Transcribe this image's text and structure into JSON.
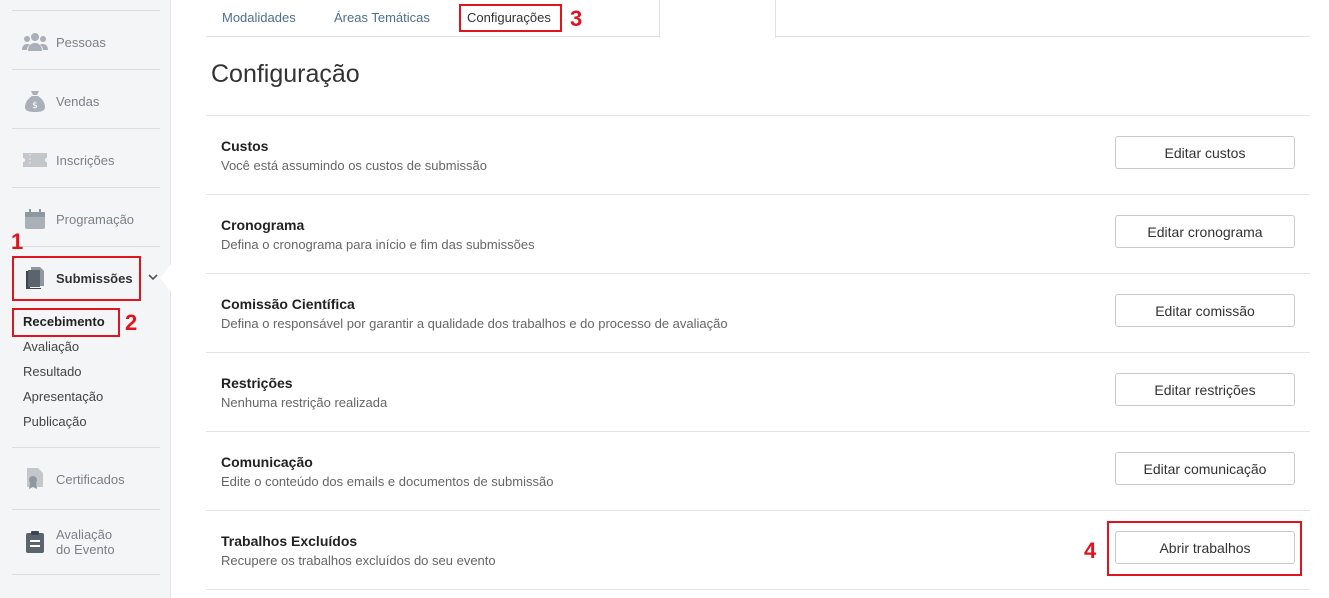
{
  "sidebar": {
    "items": [
      {
        "label": "Pessoas",
        "icon": "people-icon"
      },
      {
        "label": "Vendas",
        "icon": "money-bag-icon"
      },
      {
        "label": "Inscrições",
        "icon": "ticket-icon"
      },
      {
        "label": "Programação",
        "icon": "calendar-icon"
      },
      {
        "label": "Submissões",
        "icon": "document-icon"
      },
      {
        "label": "Certificados",
        "icon": "certificate-icon"
      },
      {
        "label_line1": "Avaliação",
        "label_line2": "do Evento",
        "icon": "clipboard-icon"
      }
    ],
    "submenu": [
      "Recebimento",
      "Avaliação",
      "Resultado",
      "Apresentação",
      "Publicação"
    ]
  },
  "tabs": [
    "Modalidades",
    "Áreas Temáticas",
    "Configurações"
  ],
  "page_title": "Configuração",
  "rows": [
    {
      "title": "Custos",
      "desc": "Você está assumindo os custos de submissão",
      "button": "Editar custos"
    },
    {
      "title": "Cronograma",
      "desc": "Defina o cronograma para início e fim das submissões",
      "button": "Editar cronograma"
    },
    {
      "title": "Comissão Científica",
      "desc": "Defina o responsável por garantir a qualidade dos trabalhos e do processo de avaliação",
      "button": "Editar comissão"
    },
    {
      "title": "Restrições",
      "desc": "Nenhuma restrição realizada",
      "button": "Editar restrições"
    },
    {
      "title": "Comunicação",
      "desc": "Edite o conteúdo dos emails e documentos de submissão",
      "button": "Editar comunicação"
    },
    {
      "title": "Trabalhos Excluídos",
      "desc": "Recupere os trabalhos excluídos do seu evento",
      "button": "Abrir trabalhos"
    }
  ],
  "annotations": [
    "1",
    "2",
    "3",
    "4"
  ],
  "colors": {
    "annotation_red": "#e0141e",
    "tab_link": "#4d6f8f",
    "sidebar_bg": "#f4f5f6"
  }
}
